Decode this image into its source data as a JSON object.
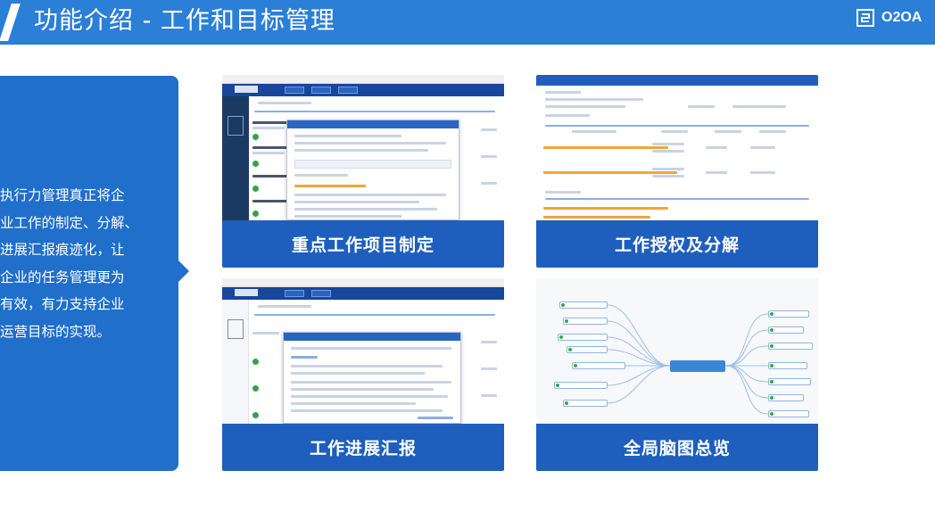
{
  "header": {
    "title": "功能介绍 - 工作和目标管理",
    "logo_text": "O2OA"
  },
  "intro": {
    "description": "执行力管理真正将企\n业工作的制定、分解、\n进展汇报痕迹化，让\n企业的任务管理更为\n有效，有力支持企业\n运营目标的实现。"
  },
  "features": [
    {
      "caption": "重点工作项目制定"
    },
    {
      "caption": "工作授权及分解"
    },
    {
      "caption": "工作进展汇报"
    },
    {
      "caption": "全局脑图总览"
    }
  ],
  "colors": {
    "brand_blue": "#2b7fd6",
    "banner_blue": "#1e5fbd",
    "panel_blue": "#1f6fcb"
  }
}
